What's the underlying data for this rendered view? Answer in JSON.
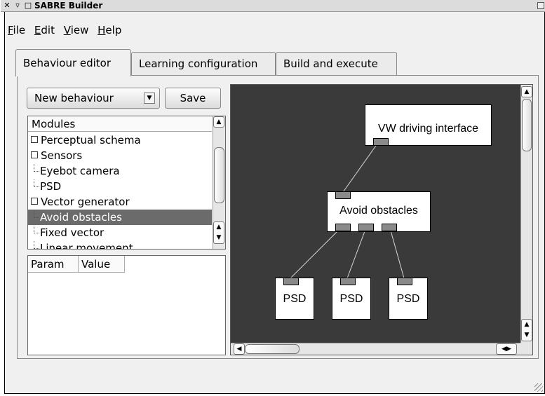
{
  "window": {
    "title": "SABRE Builder",
    "controls": {
      "close": "✕",
      "menu": "▿",
      "shade": "□"
    }
  },
  "menubar": {
    "items": [
      {
        "mnemonic": "F",
        "rest": "ile"
      },
      {
        "mnemonic": "E",
        "rest": "dit"
      },
      {
        "mnemonic": "V",
        "rest": "iew"
      },
      {
        "mnemonic": "H",
        "rest": "elp"
      }
    ]
  },
  "tabs": [
    "Behaviour editor",
    "Learning configuration",
    "Build and execute"
  ],
  "toolbar": {
    "behaviour_combo": "New behaviour",
    "save_label": "Save"
  },
  "modules": {
    "header": "Modules",
    "items": [
      {
        "label": "Perceptual schema",
        "kind": "group"
      },
      {
        "label": "Sensors",
        "kind": "group"
      },
      {
        "label": "Eyebot camera",
        "kind": "child"
      },
      {
        "label": "PSD",
        "kind": "child"
      },
      {
        "label": "Vector generator",
        "kind": "group"
      },
      {
        "label": "Avoid obstacles",
        "kind": "child",
        "selected": true
      },
      {
        "label": "Fixed vector",
        "kind": "child"
      },
      {
        "label": "Linear movement",
        "kind": "child"
      }
    ]
  },
  "params": {
    "col_param": "Param",
    "col_value": "Value"
  },
  "canvas": {
    "nodes": {
      "vw": "VW driving interface",
      "avoid": "Avoid obstacles",
      "psd1": "PSD",
      "psd2": "PSD",
      "psd3": "PSD"
    }
  }
}
